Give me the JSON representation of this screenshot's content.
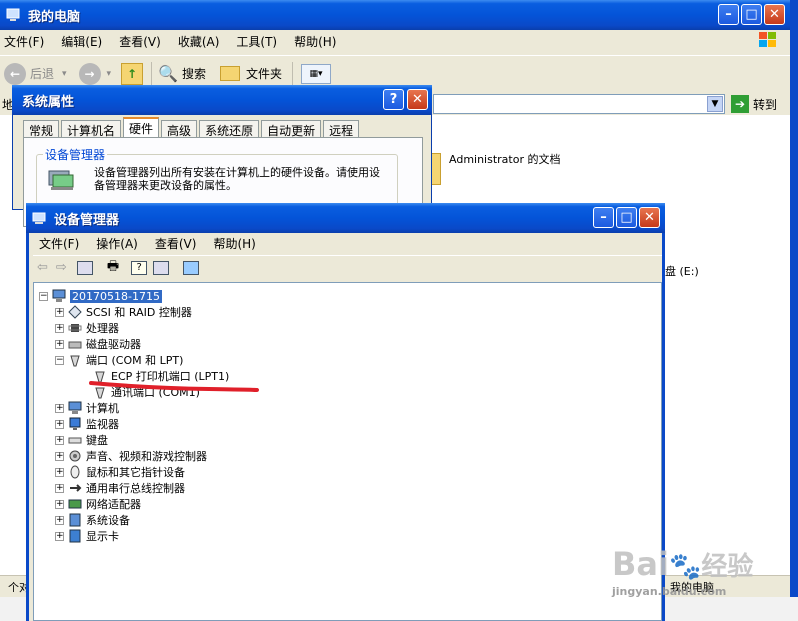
{
  "my_computer": {
    "title": "我的电脑",
    "menu": [
      "文件(F)",
      "编辑(E)",
      "查看(V)",
      "收藏(A)",
      "工具(T)",
      "帮助(H)"
    ],
    "toolbar": {
      "back": "后退",
      "search": "搜索",
      "folders": "文件夹"
    },
    "address_label": "地",
    "go_label": "转到",
    "items": [
      "Administrator 的文档",
      "盘 (E:)"
    ],
    "status_left": "个对",
    "status_right": "我的电脑"
  },
  "system_properties": {
    "title": "系统属性",
    "tabs": [
      "常规",
      "计算机名",
      "硬件",
      "高级",
      "系统还原",
      "自动更新",
      "远程"
    ],
    "active_tab": "硬件",
    "group_title": "设备管理器",
    "group_text": "设备管理器列出所有安装在计算机上的硬件设备。请使用设备管理器来更改设备的属性。"
  },
  "device_manager": {
    "title": "设备管理器",
    "menu": [
      "文件(F)",
      "操作(A)",
      "查看(V)",
      "帮助(H)"
    ],
    "tree": {
      "root": "20170518-1715",
      "nodes": [
        {
          "label": "SCSI 和 RAID 控制器",
          "icon": "scsi-icon",
          "expanded": false
        },
        {
          "label": "处理器",
          "icon": "processor-icon",
          "expanded": false
        },
        {
          "label": "磁盘驱动器",
          "icon": "disk-drive-icon",
          "expanded": false
        },
        {
          "label": "端口 (COM 和 LPT)",
          "icon": "port-icon",
          "expanded": true,
          "children": [
            {
              "label": "ECP 打印机端口 (LPT1)",
              "icon": "port-icon",
              "highlighted": true
            },
            {
              "label": "通讯端口 (COM1)",
              "icon": "port-icon"
            }
          ]
        },
        {
          "label": "计算机",
          "icon": "computer-icon",
          "expanded": false
        },
        {
          "label": "监视器",
          "icon": "monitor-icon",
          "expanded": false
        },
        {
          "label": "键盘",
          "icon": "keyboard-icon",
          "expanded": false
        },
        {
          "label": "声音、视频和游戏控制器",
          "icon": "sound-icon",
          "expanded": false
        },
        {
          "label": "鼠标和其它指针设备",
          "icon": "mouse-icon",
          "expanded": false
        },
        {
          "label": "通用串行总线控制器",
          "icon": "usb-icon",
          "expanded": false
        },
        {
          "label": "网络适配器",
          "icon": "network-adapter-icon",
          "expanded": false
        },
        {
          "label": "系统设备",
          "icon": "system-device-icon",
          "expanded": false
        },
        {
          "label": "显示卡",
          "icon": "display-adapter-icon",
          "expanded": false
        }
      ]
    },
    "annotation_color": "#e0202a"
  },
  "watermark": {
    "brand": "Bai",
    "brand2": "经验",
    "url": "jingyan.baidu.com"
  },
  "colors": {
    "title_bar": "#0454d8",
    "selection": "#316ac5",
    "window_face": "#ece9d8"
  }
}
